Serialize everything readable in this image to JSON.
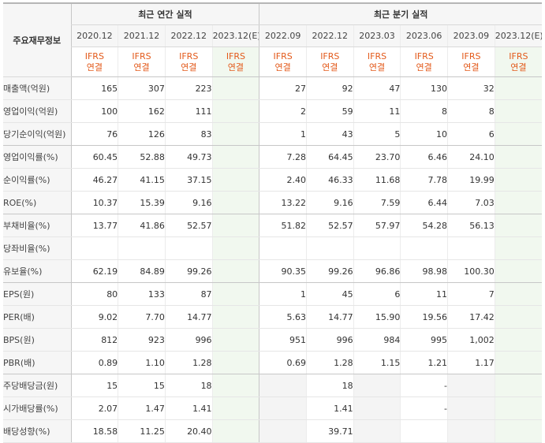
{
  "header": {
    "label": "주요재무정보",
    "annual_title": "최근 연간 실적",
    "quarter_title": "최근 분기 실적",
    "annual_periods": [
      "2020.12",
      "2021.12",
      "2022.12",
      "2023.12(E)"
    ],
    "quarter_periods": [
      "2022.09",
      "2022.12",
      "2023.03",
      "2023.06",
      "2023.09",
      "2023.12(E)"
    ],
    "ifrs_line1": "IFRS",
    "ifrs_line2": "연결"
  },
  "rows": [
    {
      "label": "매출액(억원)",
      "annual": [
        "165",
        "307",
        "223",
        ""
      ],
      "quarter": [
        "27",
        "92",
        "47",
        "130",
        "32",
        ""
      ]
    },
    {
      "label": "영업이익(억원)",
      "annual": [
        "100",
        "162",
        "111",
        ""
      ],
      "quarter": [
        "2",
        "59",
        "11",
        "8",
        "8",
        ""
      ]
    },
    {
      "label": "당기순이익(억원)",
      "annual": [
        "76",
        "126",
        "83",
        ""
      ],
      "quarter": [
        "1",
        "43",
        "5",
        "10",
        "6",
        ""
      ]
    },
    {
      "label": "영업이익률(%)",
      "annual": [
        "60.45",
        "52.88",
        "49.73",
        ""
      ],
      "quarter": [
        "7.28",
        "64.45",
        "23.70",
        "6.46",
        "24.10",
        ""
      ]
    },
    {
      "label": "순이익률(%)",
      "annual": [
        "46.27",
        "41.15",
        "37.15",
        ""
      ],
      "quarter": [
        "2.40",
        "46.33",
        "11.68",
        "7.78",
        "19.99",
        ""
      ]
    },
    {
      "label": "ROE(%)",
      "annual": [
        "10.37",
        "15.39",
        "9.16",
        ""
      ],
      "quarter": [
        "13.22",
        "9.16",
        "7.59",
        "6.44",
        "7.03",
        ""
      ]
    },
    {
      "label": "부채비율(%)",
      "annual": [
        "13.77",
        "41.86",
        "52.57",
        ""
      ],
      "quarter": [
        "51.82",
        "52.57",
        "57.97",
        "54.28",
        "56.13",
        ""
      ]
    },
    {
      "label": "당좌비율(%)",
      "annual": [
        "",
        "",
        "",
        ""
      ],
      "quarter": [
        "",
        "",
        "",
        "",
        "",
        ""
      ]
    },
    {
      "label": "유보율(%)",
      "annual": [
        "62.19",
        "84.89",
        "99.26",
        ""
      ],
      "quarter": [
        "90.35",
        "99.26",
        "96.86",
        "98.98",
        "100.30",
        ""
      ]
    },
    {
      "label": "EPS(원)",
      "annual": [
        "80",
        "133",
        "87",
        ""
      ],
      "quarter": [
        "1",
        "45",
        "6",
        "11",
        "7",
        ""
      ]
    },
    {
      "label": "PER(배)",
      "annual": [
        "9.02",
        "7.70",
        "14.77",
        ""
      ],
      "quarter": [
        "5.63",
        "14.77",
        "15.90",
        "19.56",
        "17.42",
        ""
      ]
    },
    {
      "label": "BPS(원)",
      "annual": [
        "812",
        "923",
        "996",
        ""
      ],
      "quarter": [
        "951",
        "996",
        "984",
        "995",
        "1,002",
        ""
      ]
    },
    {
      "label": "PBR(배)",
      "annual": [
        "0.89",
        "1.10",
        "1.28",
        ""
      ],
      "quarter": [
        "0.69",
        "1.28",
        "1.15",
        "1.21",
        "1.17",
        ""
      ]
    },
    {
      "label": "주당배당금(원)",
      "annual": [
        "15",
        "15",
        "18",
        ""
      ],
      "quarter": [
        "",
        "18",
        "",
        "-",
        "",
        ""
      ]
    },
    {
      "label": "시가배당률(%)",
      "annual": [
        "2.07",
        "1.47",
        "1.41",
        ""
      ],
      "quarter": [
        "",
        "1.41",
        "",
        "-",
        "",
        ""
      ]
    },
    {
      "label": "배당성향(%)",
      "annual": [
        "18.58",
        "11.25",
        "20.40",
        ""
      ],
      "quarter": [
        "",
        "39.71",
        "",
        "",
        "",
        ""
      ]
    }
  ]
}
